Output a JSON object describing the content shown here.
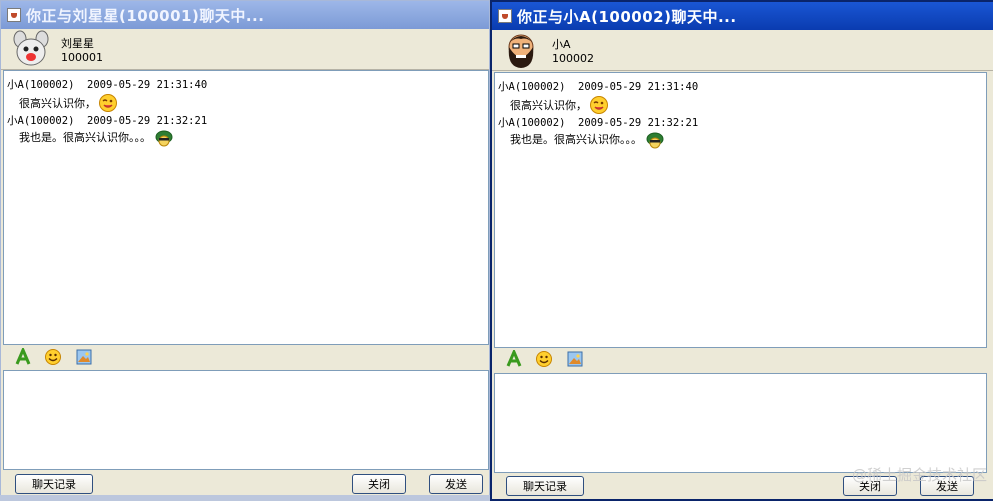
{
  "window1": {
    "title": "你正与刘星星(100001)聊天中...",
    "contact": {
      "name": "刘星星",
      "id": "100001"
    },
    "messages": [
      {
        "meta": "小A(100002)  2009-05-29 21:31:40",
        "text": "很高兴认识你，",
        "emoji": "wink-emoji-icon"
      },
      {
        "meta": "小A(100002)  2009-05-29 21:32:21",
        "text": "我也是。很高兴认识你。。。",
        "emoji": "turtle-emoji-icon"
      }
    ],
    "buttons": {
      "history": "聊天记录",
      "close": "关闭",
      "send": "发送"
    }
  },
  "window2": {
    "title": "你正与小A(100002)聊天中...",
    "contact": {
      "name": "小A",
      "id": "100002"
    },
    "messages": [
      {
        "meta": "小A(100002)  2009-05-29 21:31:40",
        "text": "很高兴认识你，",
        "emoji": "wink-emoji-icon"
      },
      {
        "meta": "小A(100002)  2009-05-29 21:32:21",
        "text": "我也是。很高兴认识你。。。",
        "emoji": "turtle-emoji-icon"
      }
    ],
    "buttons": {
      "history": "聊天记录",
      "close": "关闭",
      "send": "发送"
    }
  },
  "toolbar_icons": [
    "font-icon",
    "emoticon-icon",
    "image-icon"
  ],
  "watermark": "@稀土掘金技术社区",
  "colors": {
    "active_title": "#0a3cb0",
    "inactive_title": "#7c9ad6",
    "panel": "#ece9d8"
  }
}
